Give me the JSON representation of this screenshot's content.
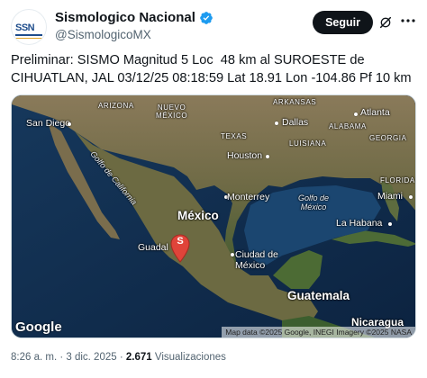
{
  "account": {
    "display_name": "Sismologico Nacional",
    "handle": "@SismologicoMX",
    "avatar_text": "SSN",
    "verified_icon": "verified-badge-icon"
  },
  "actions": {
    "follow_label": "Seguir"
  },
  "tweet": {
    "text": "Preliminar: SISMO Magnitud 5 Loc  48 km al SUROESTE de CIHUATLAN, JAL 03/12/25 08:18:59 Lat 18.91 Lon -104.86 Pf 10 km"
  },
  "map": {
    "pin_label": "S",
    "google_logo": "Google",
    "attribution": "Map data ©2025 Google, INEGI Imagery ©2025 NASA",
    "labels": {
      "san_diego": "San Diego",
      "arizona": "ARIZONA",
      "nuevo_mexico": "NUEVO\nMÉXICO",
      "arkansas": "ARKANSAS",
      "atlanta": "Atlanta",
      "dallas": "Dallas",
      "alabama": "ALABAMA",
      "georgia": "GEORGIA",
      "texas": "TEXAS",
      "luisiana": "LUISIANA",
      "houston": "Houston",
      "florida": "FLORIDA",
      "golfo_california": "Golfo de California",
      "monterrey": "Monterrey",
      "golfo_mexico": "Golfo de\nMéxico",
      "miami": "Miami",
      "mexico": "México",
      "la_habana": "La Habana",
      "guadalajara": "Guadal",
      "ciudad_mexico": "Ciudad de\nMéxico",
      "guatemala": "Guatemala",
      "nicaragua": "Nicaragua"
    }
  },
  "meta": {
    "time": "8:26 a. m.",
    "date": "3 dic. 2025",
    "views_count": "2.671",
    "views_label": "Visualizaciones"
  }
}
